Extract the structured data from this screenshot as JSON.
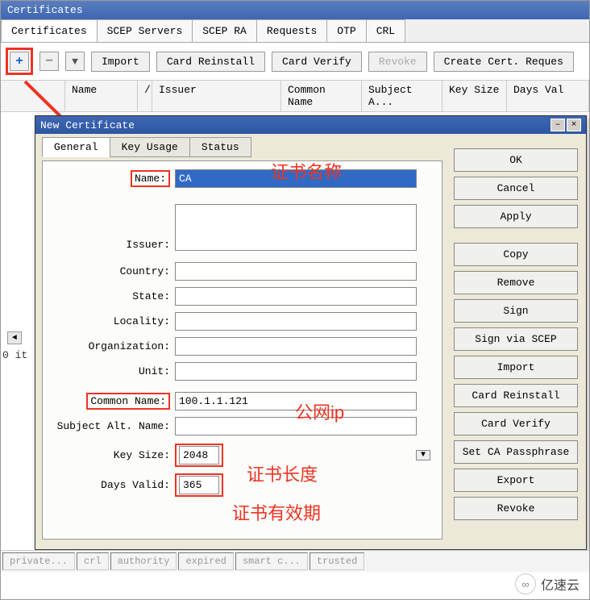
{
  "window_title": "Certificates",
  "main_tabs": [
    "Certificates",
    "SCEP Servers",
    "SCEP RA",
    "Requests",
    "OTP",
    "CRL"
  ],
  "toolbar": {
    "import": "Import",
    "card_reinstall": "Card Reinstall",
    "card_verify": "Card Verify",
    "revoke": "Revoke",
    "create_cert": "Create Cert. Reques"
  },
  "columns": [
    "",
    "Name",
    "/",
    "Issuer",
    "Common Name",
    "Subject A...",
    "Key Size",
    "Days Val"
  ],
  "item_count_label": "0 it",
  "dialog": {
    "title": "New Certificate",
    "tabs": [
      "General",
      "Key Usage",
      "Status"
    ],
    "fields": {
      "name_label": "Name:",
      "name_value": "CA",
      "issuer_label": "Issuer:",
      "country_label": "Country:",
      "state_label": "State:",
      "locality_label": "Locality:",
      "organization_label": "Organization:",
      "unit_label": "Unit:",
      "common_name_label": "Common Name:",
      "common_name_value": "100.1.1.121",
      "san_label": "Subject Alt. Name:",
      "key_size_label": "Key Size:",
      "key_size_value": "2048",
      "days_valid_label": "Days Valid:",
      "days_valid_value": "365"
    },
    "buttons": {
      "ok": "OK",
      "cancel": "Cancel",
      "apply": "Apply",
      "copy": "Copy",
      "remove": "Remove",
      "sign": "Sign",
      "sign_scep": "Sign via SCEP",
      "import": "Import",
      "card_reinstall": "Card Reinstall",
      "card_verify": "Card Verify",
      "set_ca_pass": "Set CA Passphrase",
      "export": "Export",
      "revoke": "Revoke"
    }
  },
  "annotations": {
    "cert_name": "证书名称",
    "public_ip": "公网ip",
    "cert_len": "证书长度",
    "cert_valid": "证书有效期"
  },
  "status_tabs": [
    "private...",
    "crl",
    "authority",
    "expired",
    "smart c...",
    "trusted"
  ],
  "brand": "亿速云"
}
